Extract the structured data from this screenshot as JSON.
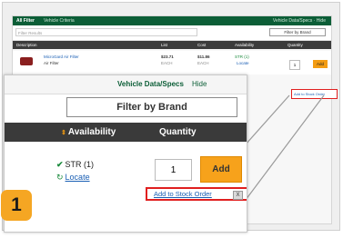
{
  "background": {
    "header_title": "All Filter",
    "header_sub": "Vehicle Criteria",
    "header_right": "Vehicle Data/Specs · Hide",
    "search_placeholder": "Filter Results",
    "filter_by_brand": "Filter by Brand",
    "columns": [
      "Description",
      "List",
      "Cost",
      "Availability",
      "Quantity"
    ],
    "row": {
      "product_name": "MicroGard Air Filter",
      "category": "Air Filter",
      "list": "$23.71",
      "list_unit": "EACH",
      "cost": "$11.86",
      "cost_unit": "EACH",
      "availability": "STR (1)",
      "locate": "Locate",
      "quantity": "1",
      "add_label": "Add"
    },
    "add_to_stock_order": "Add to Stock Order"
  },
  "zoom": {
    "vehicle_data": "Vehicle Data/Specs",
    "hide": "Hide",
    "filter_by_brand": "Filter by Brand",
    "col_availability": "Availability",
    "col_quantity": "Quantity",
    "availability": "STR (1)",
    "locate": "Locate",
    "quantity": "1",
    "add_label": "Add",
    "add_to_stock_order": "Add to Stock Order",
    "close_glyph": "X"
  },
  "step_number": "1",
  "colors": {
    "header_green": "#0c5e37",
    "accent_orange": "#f7a21b",
    "highlight_red": "#e01f1f",
    "link_blue": "#1a5fb4"
  }
}
